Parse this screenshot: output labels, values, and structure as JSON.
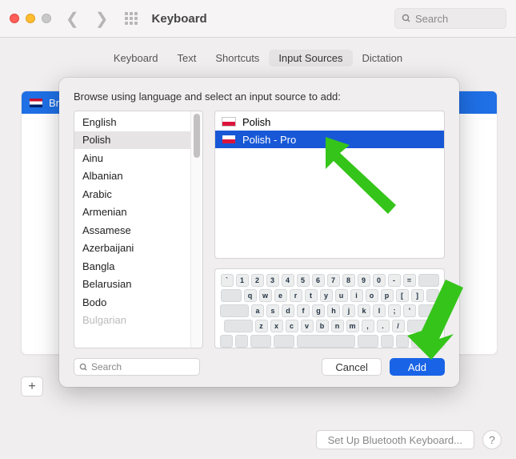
{
  "titlebar": {
    "title": "Keyboard",
    "search_placeholder": "Search"
  },
  "tabs": [
    {
      "label": "Keyboard",
      "active": false
    },
    {
      "label": "Text",
      "active": false
    },
    {
      "label": "Shortcuts",
      "active": false
    },
    {
      "label": "Input Sources",
      "active": true
    },
    {
      "label": "Dictation",
      "active": false
    }
  ],
  "bg_selected_source": "British",
  "sheet": {
    "prompt": "Browse using language and select an input source to add:",
    "languages": [
      "English",
      "Polish",
      "Ainu",
      "Albanian",
      "Arabic",
      "Armenian",
      "Assamese",
      "Azerbaijani",
      "Bangla",
      "Belarusian",
      "Bodo",
      "Bulgarian"
    ],
    "selected_language_index": 1,
    "sources": [
      {
        "label": "Polish",
        "selected": false
      },
      {
        "label": "Polish - Pro",
        "selected": true
      }
    ],
    "keyboard_rows": [
      [
        "`",
        "1",
        "2",
        "3",
        "4",
        "5",
        "6",
        "7",
        "8",
        "9",
        "0",
        "-",
        "="
      ],
      [
        "q",
        "w",
        "e",
        "r",
        "t",
        "y",
        "u",
        "i",
        "o",
        "p",
        "[",
        "]"
      ],
      [
        "a",
        "s",
        "d",
        "f",
        "g",
        "h",
        "j",
        "k",
        "l",
        ";",
        "'"
      ],
      [
        "z",
        "x",
        "c",
        "v",
        "b",
        "n",
        "m",
        ",",
        ".",
        "/"
      ]
    ],
    "search_placeholder": "Search",
    "cancel_label": "Cancel",
    "add_label": "Add"
  },
  "bottom": {
    "bluetooth_label": "Set Up Bluetooth Keyboard...",
    "help_label": "?"
  }
}
